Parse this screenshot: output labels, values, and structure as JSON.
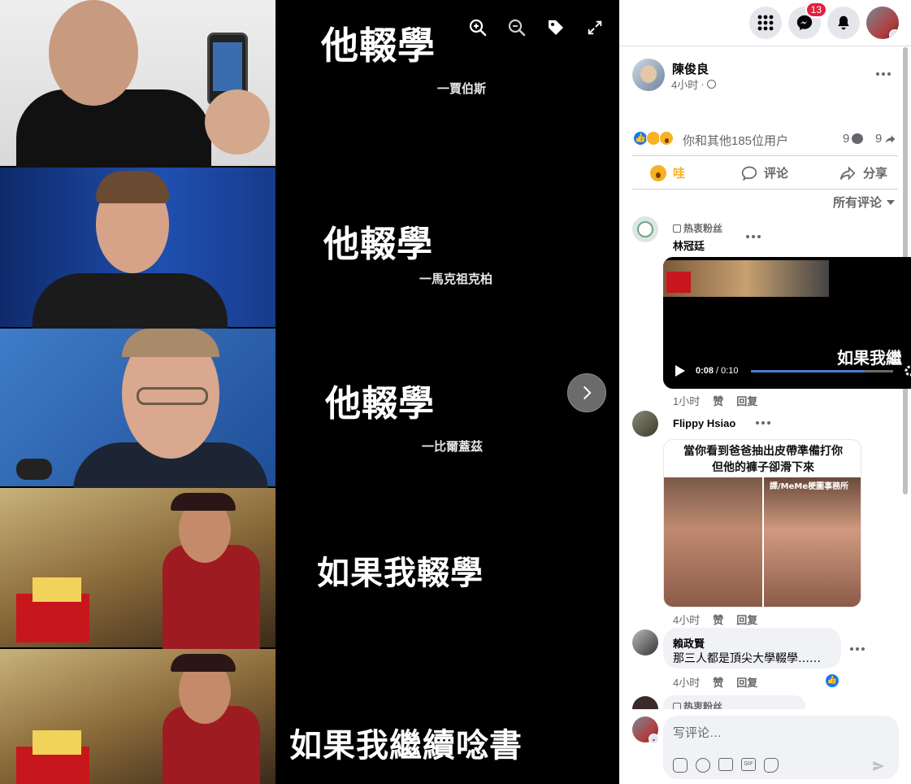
{
  "viewer": {
    "panels": [
      {
        "caption": "他輟學",
        "credit": "一賈伯斯"
      },
      {
        "caption": "他輟學",
        "credit": "一馬克祖克柏"
      },
      {
        "caption": "他輟學",
        "credit": "一比爾蓋茲"
      },
      {
        "caption": "如果我輟學",
        "credit": ""
      },
      {
        "caption": "如果我繼續唸書",
        "credit": ""
      }
    ],
    "tools": [
      "zoom-in-icon",
      "zoom-out-icon",
      "tag-icon",
      "fullscreen-icon"
    ]
  },
  "topbar": {
    "notification_count": "13"
  },
  "post": {
    "author": "陳俊良",
    "time": "4小时",
    "audience_sep": "·",
    "reaction_summary": "你和其他185位用户",
    "comment_count": "9",
    "share_count": "9",
    "actions": {
      "react": "哇",
      "comment": "评论",
      "share": "分享"
    },
    "comment_filter": "所有评论"
  },
  "comments": [
    {
      "badge": "热衷粉丝",
      "author": "林冠廷",
      "video": {
        "overlay_text": "如果我繼",
        "time": "0:08",
        "duration": "0:10",
        "sep": "/",
        "progress": 0.8
      },
      "time": "1小时",
      "like": "赞",
      "reply": "回复"
    },
    {
      "author": "Flippy Hsiao",
      "meme": {
        "line1": "當你看到爸爸抽出皮帶準備打你",
        "line2": "但他的褲子卻滑下來",
        "watermark": "譯/MeMe梗圖事務所"
      },
      "time": "4小时",
      "like": "赞",
      "reply": "回复"
    },
    {
      "author": "賴政賢",
      "text": "那三人都是頂尖大學輟學……",
      "time": "4小时",
      "like": "赞",
      "reply": "回复"
    },
    {
      "badge": "热衷粉丝"
    }
  ],
  "composer": {
    "placeholder": "写评论…"
  },
  "colors": {
    "accent": "#1877f2",
    "wow": "#f7b125",
    "viewer_bg": "#000000"
  }
}
